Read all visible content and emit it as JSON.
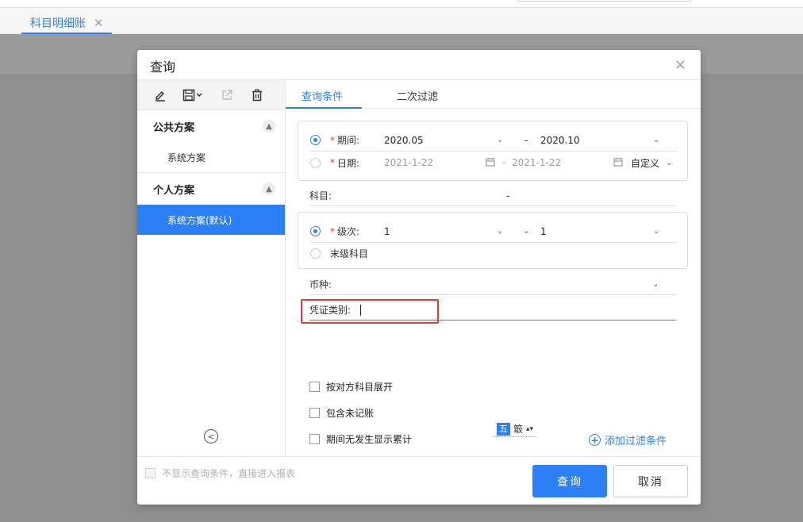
{
  "page_tab": {
    "label": "科目明细账",
    "close": "✕"
  },
  "dialog": {
    "title": "查询",
    "close": "×",
    "toolbar": {
      "edit_icon": "pencil-icon",
      "save_icon": "floppy-icon",
      "export_icon": "share-icon",
      "delete_icon": "trash-icon"
    },
    "schemes": {
      "public": {
        "title": "公共方案",
        "items": [
          "系统方案"
        ]
      },
      "personal": {
        "title": "个人方案",
        "items": [
          "系统方案(默认)"
        ]
      }
    },
    "tabs": [
      "查询条件",
      "二次过滤"
    ],
    "period": {
      "label": "期间:",
      "from": "2020.05",
      "to": "2020.10",
      "separator": "-"
    },
    "date": {
      "label": "日期:",
      "from": "2021-1-22",
      "to": "2021-1-22",
      "separator": "-",
      "preset": "自定义"
    },
    "subject": {
      "label": "科目:",
      "separator": "-"
    },
    "level": {
      "label": "级次:",
      "from": "1",
      "to": "1",
      "separator": "-"
    },
    "leaf_subject": {
      "label": "末级科目"
    },
    "currency": {
      "label": "币种:"
    },
    "voucher_type": {
      "label": "凭证类别:"
    },
    "options": [
      "按对方科目展开",
      "包含未记账",
      "期间无发生显示累计"
    ],
    "ime": {
      "mode": "五",
      "glyph": "箃"
    },
    "add_filter": "添加过滤条件",
    "skip_option": "不显示查询条件，直接进入报表",
    "buttons": {
      "query": "查询",
      "cancel": "取消"
    },
    "required_mark": "*"
  }
}
